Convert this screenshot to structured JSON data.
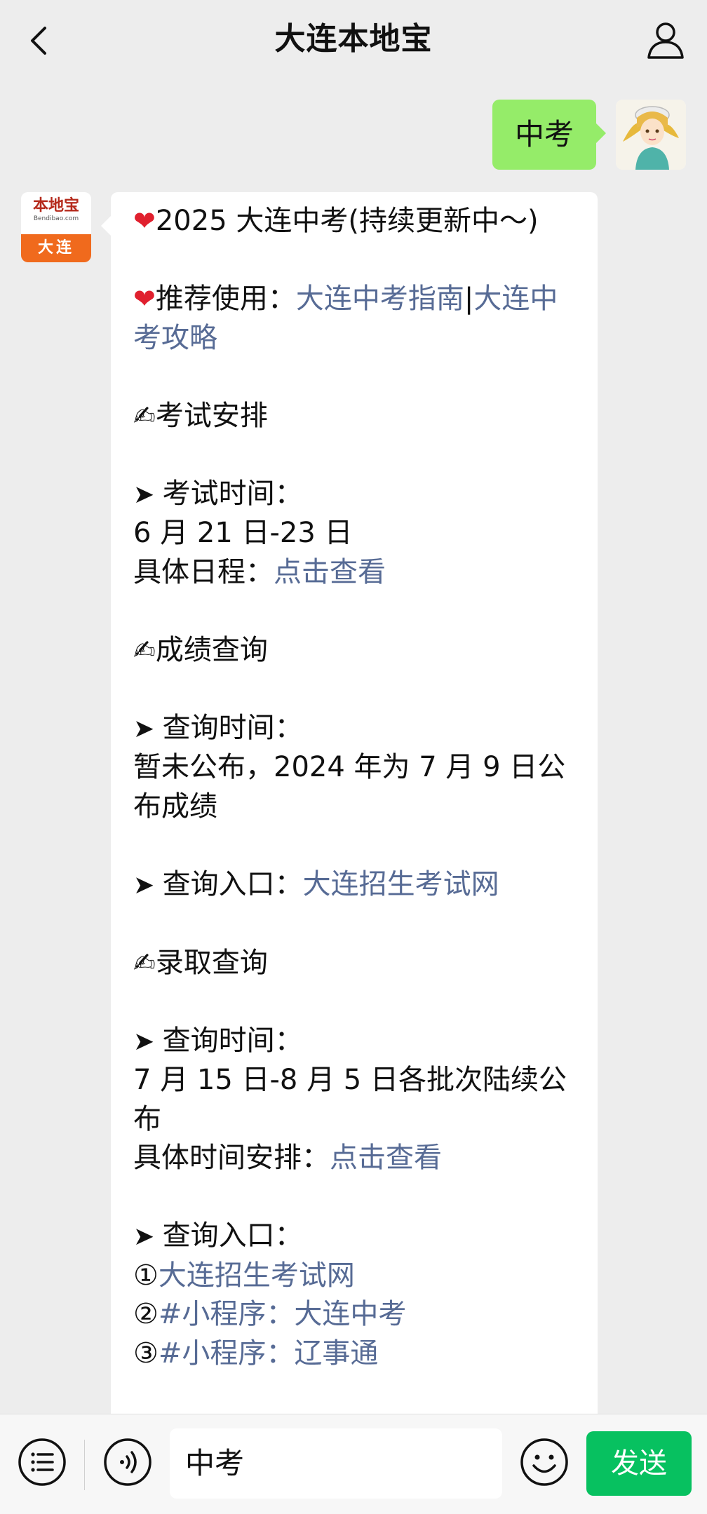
{
  "header": {
    "title": "大连本地宝",
    "back_icon": "chevron-left-icon",
    "profile_icon": "person-icon"
  },
  "outgoing_message": {
    "text": "中考"
  },
  "bot": {
    "avatar_top": "本地宝",
    "avatar_sub": "Bendibao.com",
    "avatar_bottom": "大连"
  },
  "message": {
    "l1_text": "2025 大连中考(持续更新中～)",
    "l2_prefix": "推荐使用：",
    "l2_link1": "大连中考指南",
    "l2_sep": "|",
    "l2_link2": "大连中考攻略",
    "s1_title": "考试安排",
    "s1_label": "考试时间：",
    "s1_value": "6 月 21 日-23 日",
    "s1_detail_prefix": "具体日程：",
    "s1_detail_link": "点击查看",
    "s2_title": "成绩查询",
    "s2_label": "查询时间：",
    "s2_value": "暂未公布，2024 年为 7 月 9 日公布成绩",
    "s2_entry_prefix": "查询入口：",
    "s2_entry_link": "大连招生考试网",
    "s3_title": "录取查询",
    "s3_label": "查询时间：",
    "s3_value": "7 月 15 日-8 月 5 日各批次陆续公布",
    "s3_detail_prefix": "具体时间安排：",
    "s3_detail_link": "点击查看",
    "s3_entry_label": "查询入口：",
    "entry1_num": "①",
    "entry1_link": "大连招生考试网",
    "entry2_num": "②",
    "entry2_link": "#小程序：大连中考",
    "entry3_num": "③",
    "entry3_link": "#小程序：辽事通"
  },
  "input_bar": {
    "input_value": "中考",
    "send_label": "发送",
    "menu_icon": "list-icon",
    "voice_icon": "voice-icon",
    "emoji_icon": "emoji-icon"
  },
  "colors": {
    "send_button": "#07c160",
    "outgoing_bubble": "#95ec69",
    "link": "#576b95",
    "background": "#ededed"
  }
}
